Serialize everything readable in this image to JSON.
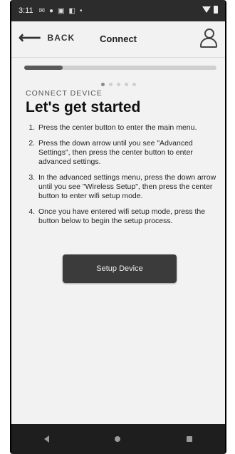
{
  "statusbar": {
    "time": "3:11",
    "icons": [
      "mail-icon",
      "messenger-icon",
      "gallery-icon",
      "screenshot-icon",
      "dot-icon"
    ]
  },
  "appbar": {
    "back_label": "BACK",
    "title": "Connect"
  },
  "progress": {
    "fraction": 0.2,
    "step": 1,
    "total_steps": 5
  },
  "content": {
    "eyebrow": "CONNECT DEVICE",
    "heading": "Let's get started",
    "steps": [
      "Press the center button to enter the main menu.",
      "Press the down arrow until you see \"Advanced Settings\", then press the center button to enter advanced settings.",
      "In the advanced settings menu, press the down arrow until you see \"Wireless Setup\", then press the center button to enter wifi setup mode.",
      "Once you have entered wifi setup mode, press the button below to begin the setup process."
    ]
  },
  "button": {
    "label": "Setup Device"
  }
}
